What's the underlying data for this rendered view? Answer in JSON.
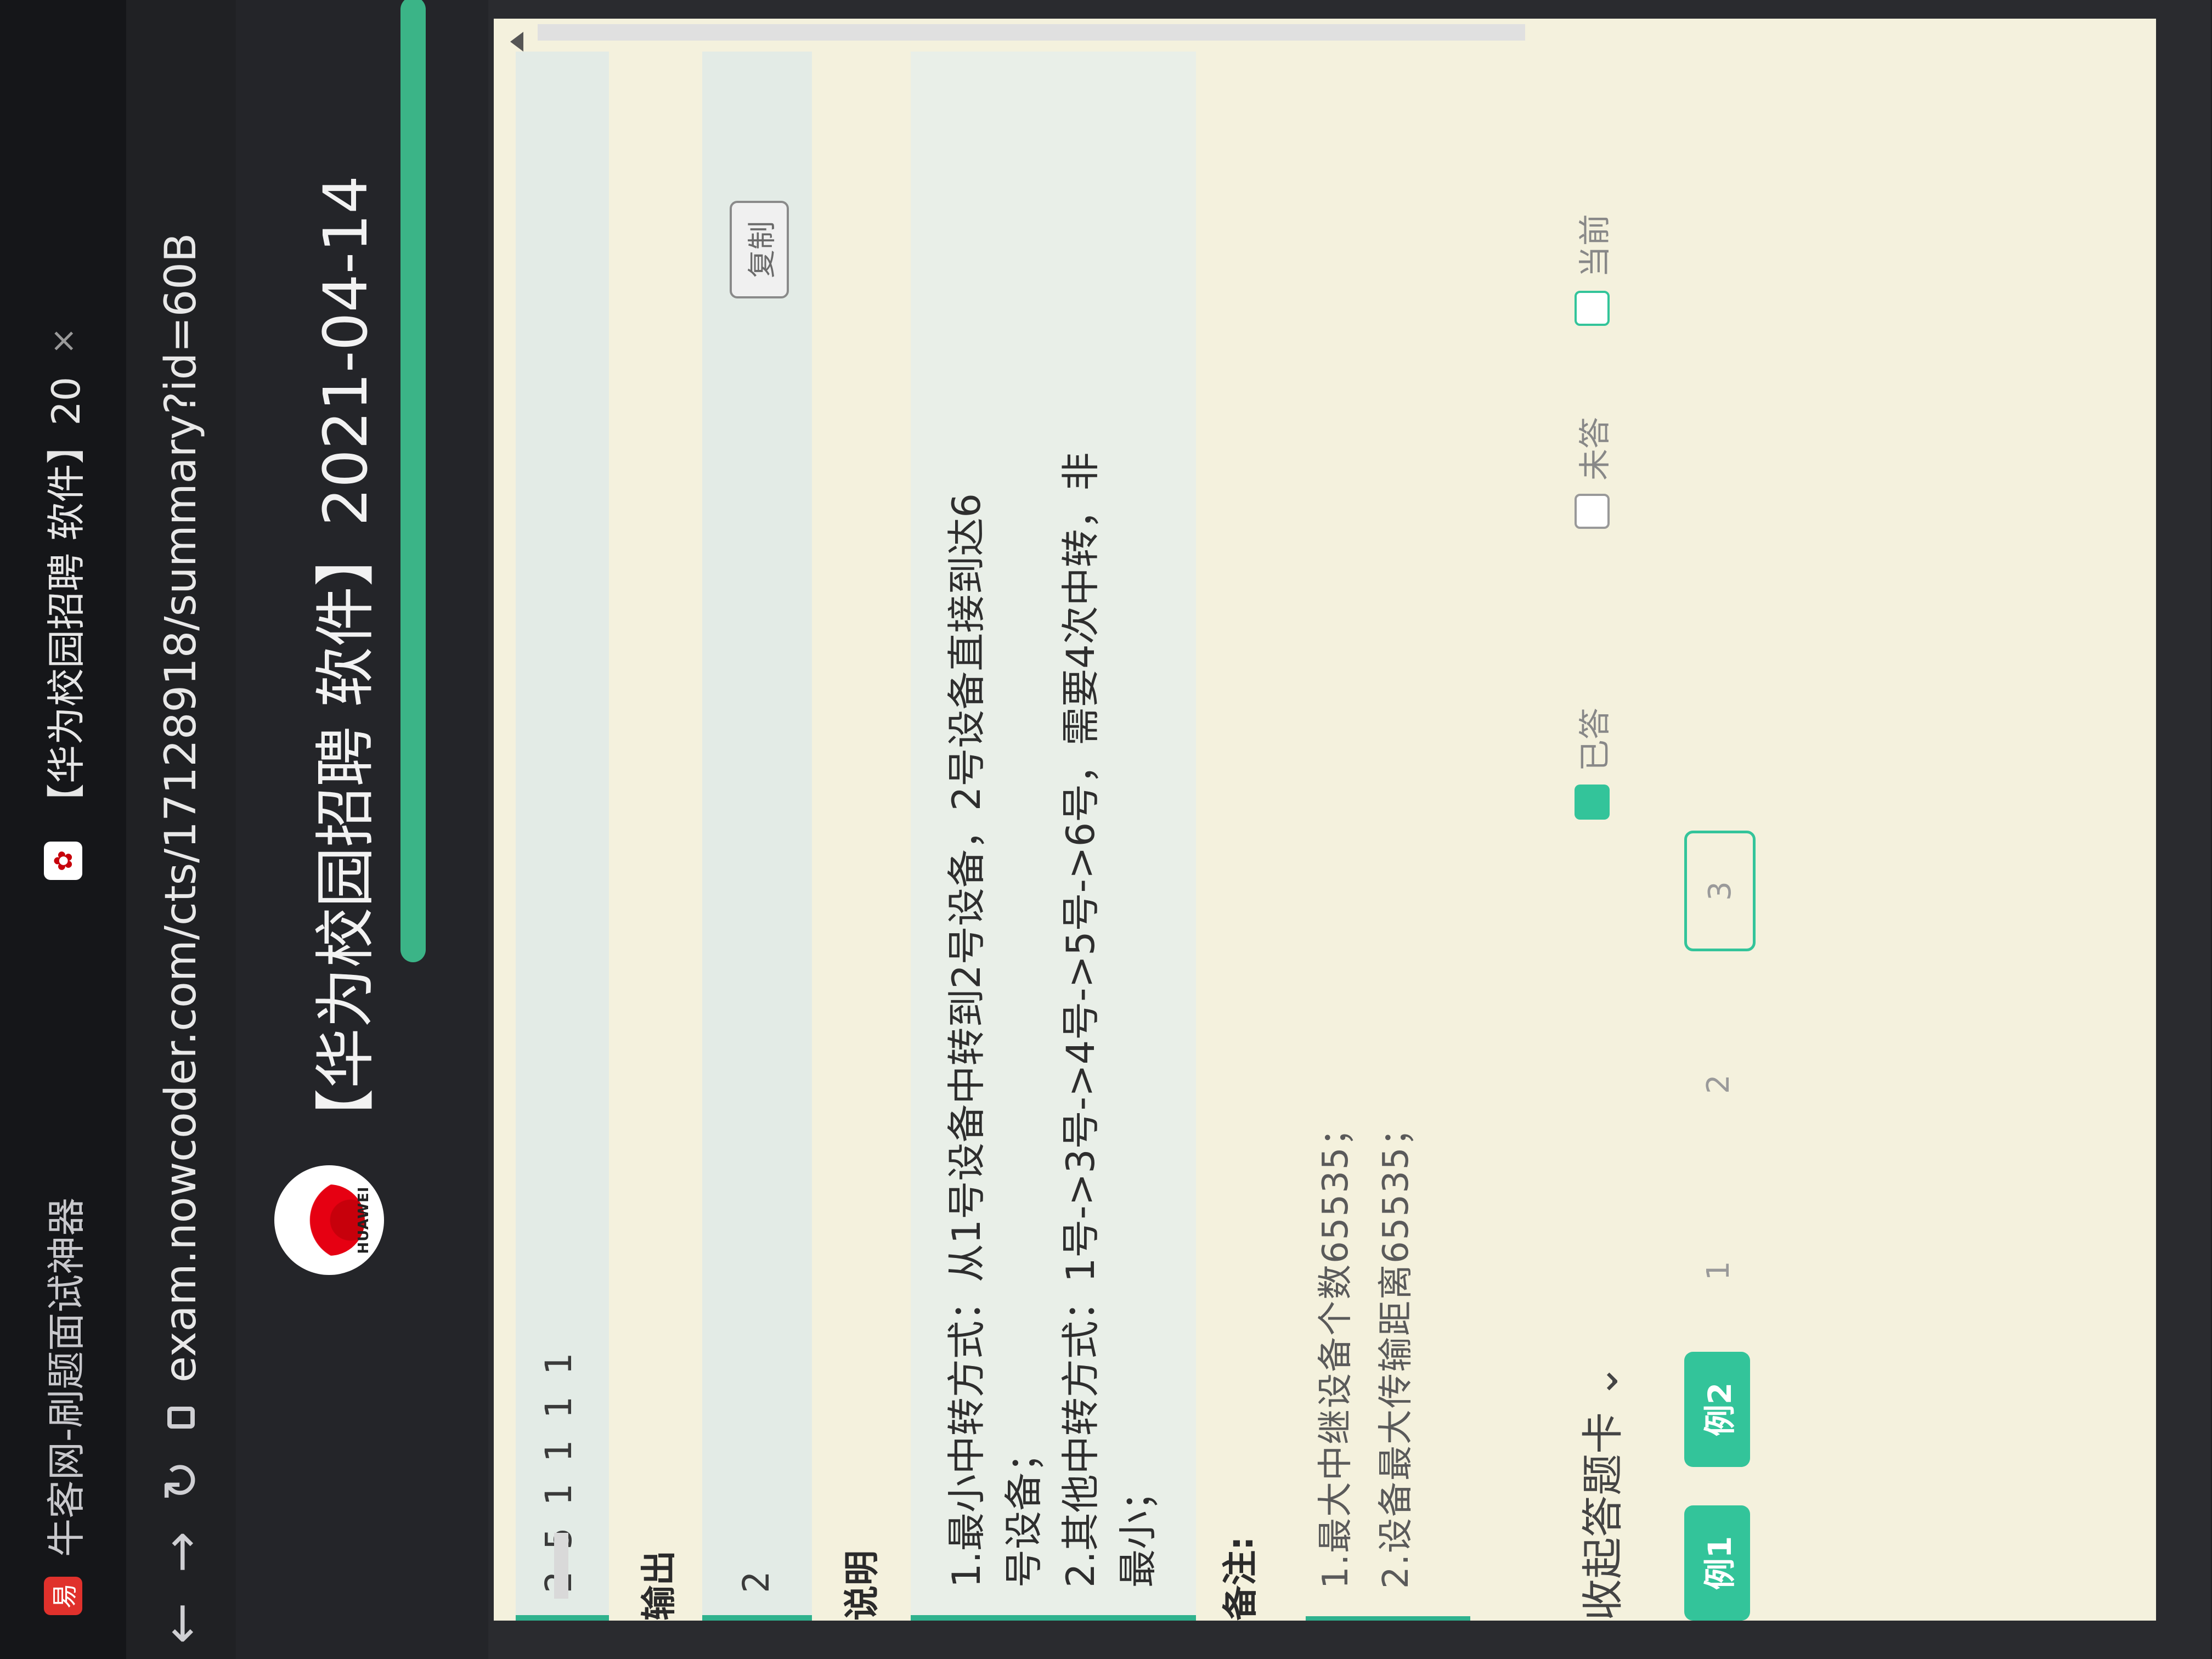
{
  "browser": {
    "tabs": [
      {
        "label": "牛客网-刷题面试神器"
      },
      {
        "label": "【华为校园招聘 软件】20",
        "close": "×"
      }
    ],
    "url": "exam.nowcoder.com/cts/17128918/summary?id=60B"
  },
  "header": {
    "logo_text": "HUAWEI",
    "title": "【华为校园招聘 软件】2021-04-14"
  },
  "content": {
    "input_value": "2 5 1 1 1 1",
    "copy_label": "复制",
    "output_label": "输出",
    "output_value": "2",
    "explain_label": "说明",
    "explain_lines": [
      "1.最小中转方式：从1号设备中转到2号设备，2号设备直接到达6",
      "号设备；",
      "2.其他中转方式：1号->3号->4号->5号->6号，需要4次中转，非",
      "最小；"
    ],
    "notes_label": "备注:",
    "notes": [
      "1.最大中继设备个数65535；",
      "2.设备最大传输距离65535；"
    ]
  },
  "answer_card": {
    "collapse_label": "收起答题卡",
    "collapse_chevron": "chevron-down-icon",
    "questions": [
      {
        "label": "例1",
        "state": "done"
      },
      {
        "label": "例2",
        "state": "done"
      },
      {
        "label": "1"
      },
      {
        "label": "2"
      },
      {
        "label": "3",
        "state": "current"
      }
    ],
    "legend": [
      {
        "label": "已答",
        "color": "#33c49a"
      },
      {
        "label": "未答",
        "color": "#ffffff"
      },
      {
        "label": "当前",
        "color": "#ffffff"
      }
    ]
  },
  "colors": {
    "accent": "#33c49a",
    "panel_bg": "#f4f1dd",
    "progress": "#3bb487"
  }
}
